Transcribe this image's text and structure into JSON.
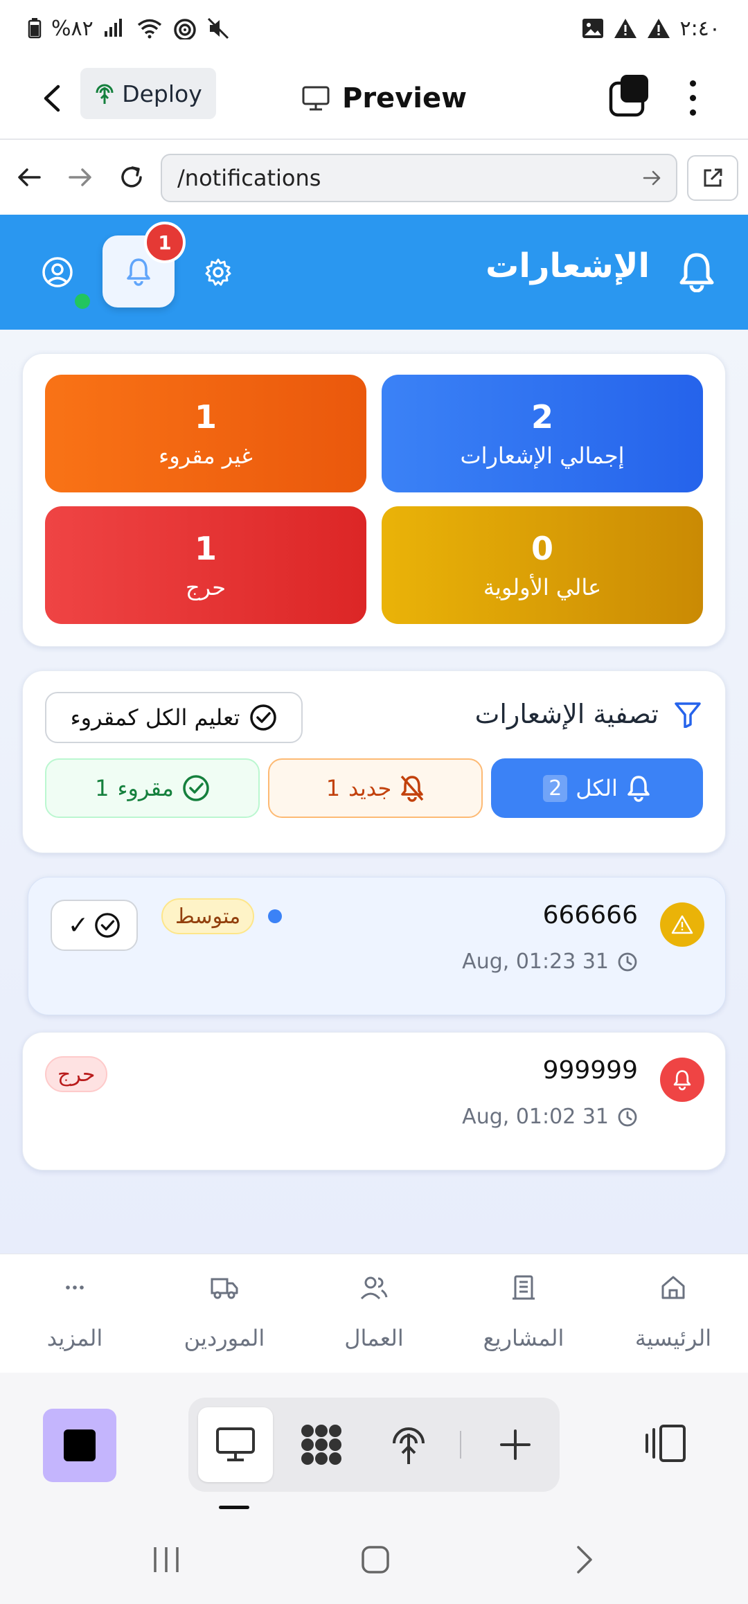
{
  "status_bar": {
    "time": "٢:٤٠",
    "battery": "%٨٢"
  },
  "app_bar": {
    "deploy_label": "Deploy",
    "preview_label": "Preview"
  },
  "browser": {
    "url": "/notifications"
  },
  "header": {
    "title": "الإشعارات",
    "badge_count": "1"
  },
  "stats": {
    "total": {
      "value": "2",
      "label": "إجمالي الإشعارات"
    },
    "unread": {
      "value": "1",
      "label": "غير مقروء"
    },
    "high_priority": {
      "value": "0",
      "label": "عالي الأولوية"
    },
    "critical": {
      "value": "1",
      "label": "حرج"
    }
  },
  "filters": {
    "title": "تصفية الإشعارات",
    "mark_all_label": "تعليم الكل كمقروء",
    "chips": {
      "all": {
        "label": "الكل",
        "count": "2"
      },
      "new": {
        "label": "جديد",
        "count": "1"
      },
      "read": {
        "label": "مقروء",
        "count": "1"
      }
    }
  },
  "notifications": [
    {
      "title": "666666",
      "time": "Aug, 01:23 31",
      "priority": "متوسط",
      "unread": true,
      "mark_read_label": "✓",
      "icon": "warning-icon"
    },
    {
      "title": "999999",
      "time": "Aug, 01:02 31",
      "priority": "حرج",
      "unread": false,
      "icon": "bell-icon"
    }
  ],
  "bottom_nav": {
    "home": "الرئيسية",
    "projects": "المشاريع",
    "workers": "العمال",
    "suppliers": "الموردين",
    "more": "المزيد"
  },
  "colors": {
    "header_blue": "#2a97f0",
    "accent_blue": "#3b82f6",
    "orange": "#f97316",
    "yellow": "#eab308",
    "red": "#ef4444"
  }
}
